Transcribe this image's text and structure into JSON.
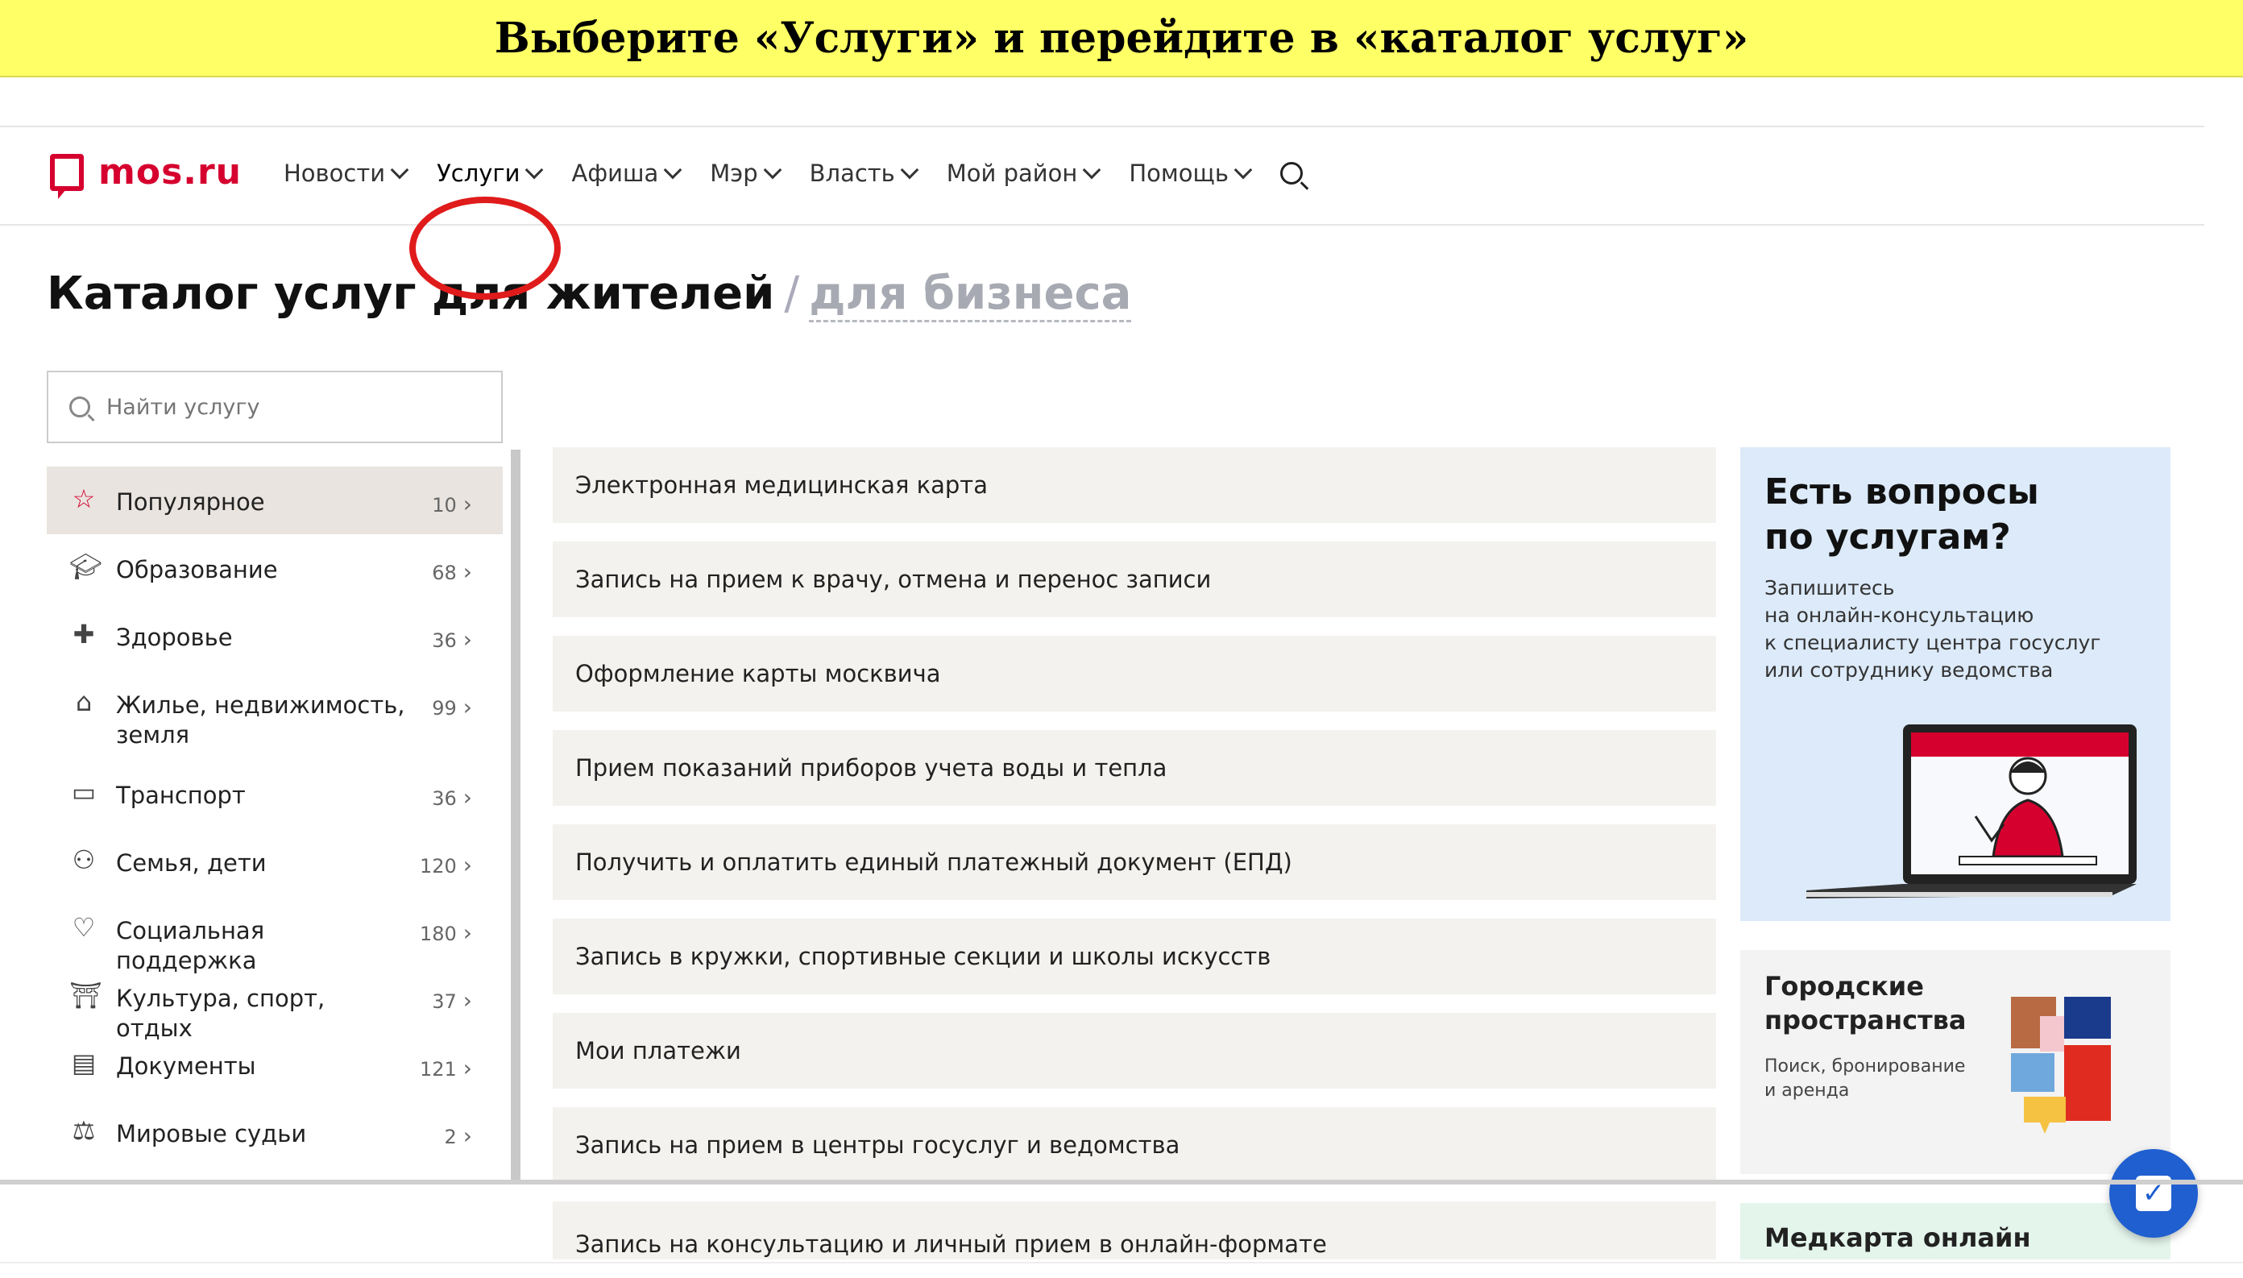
{
  "banner": {
    "text": "Выберите «Услуги» и перейдите в «каталог услуг»"
  },
  "header": {
    "logo_text": "mos.ru",
    "nav": [
      "Новости",
      "Услуги",
      "Афиша",
      "Мэр",
      "Власть",
      "Мой район",
      "Помощь"
    ],
    "active_nav": "Услуги"
  },
  "page": {
    "title_main": "Каталог услуг для жителей",
    "title_sep": "/",
    "title_alt": "для бизнеса",
    "search_placeholder": "Найти услугу"
  },
  "categories": [
    {
      "label": "Популярное",
      "count": "10",
      "icon": "star-icon",
      "selected": true
    },
    {
      "label": "Образование",
      "count": "68",
      "icon": "graduation-cap-icon"
    },
    {
      "label": "Здоровье",
      "count": "36",
      "icon": "health-cross-icon"
    },
    {
      "label": "Жилье, недвижимость, земля",
      "count": "99",
      "icon": "house-icon"
    },
    {
      "label": "Транспорт",
      "count": "36",
      "icon": "bus-icon"
    },
    {
      "label": "Семья, дети",
      "count": "120",
      "icon": "family-icon"
    },
    {
      "label": "Социальная поддержка",
      "count": "180",
      "icon": "heart-icon"
    },
    {
      "label": "Культура, спорт, отдых",
      "count": "37",
      "icon": "museum-icon"
    },
    {
      "label": "Документы",
      "count": "121",
      "icon": "document-icon"
    },
    {
      "label": "Мировые судьи",
      "count": "2",
      "icon": "gavel-icon"
    }
  ],
  "services": [
    "Электронная медицинская карта",
    "Запись на прием к врачу, отмена и перенос записи",
    "Оформление карты москвича",
    "Прием показаний приборов учета воды и тепла",
    "Получить и оплатить единый платежный документ (ЕПД)",
    "Запись в кружки, спортивные секции и школы искусств",
    "Мои платежи",
    "Запись на прием в центры госуслуг и ведомства",
    "Запись на консультацию и личный прием в онлайн-формате"
  ],
  "sidebar_cards": {
    "questions": {
      "title_line1": "Есть вопросы",
      "title_line2": "по услугам?",
      "text_line1": "Запишитесь",
      "text_line2": "на онлайн-консультацию",
      "text_line3": "к специалисту центра госуслуг",
      "text_line4": "или сотруднику ведомства"
    },
    "spaces": {
      "title_line1": "Городские",
      "title_line2": "пространства",
      "text_line1": "Поиск, бронирование",
      "text_line2": "и аренда"
    },
    "medcard": {
      "title": "Медкарта онлайн"
    }
  },
  "colors": {
    "brand": "#d6002f",
    "highlight_circle": "#e01b1b",
    "banner_bg": "#ffff66",
    "fab": "#1f5fcf"
  }
}
